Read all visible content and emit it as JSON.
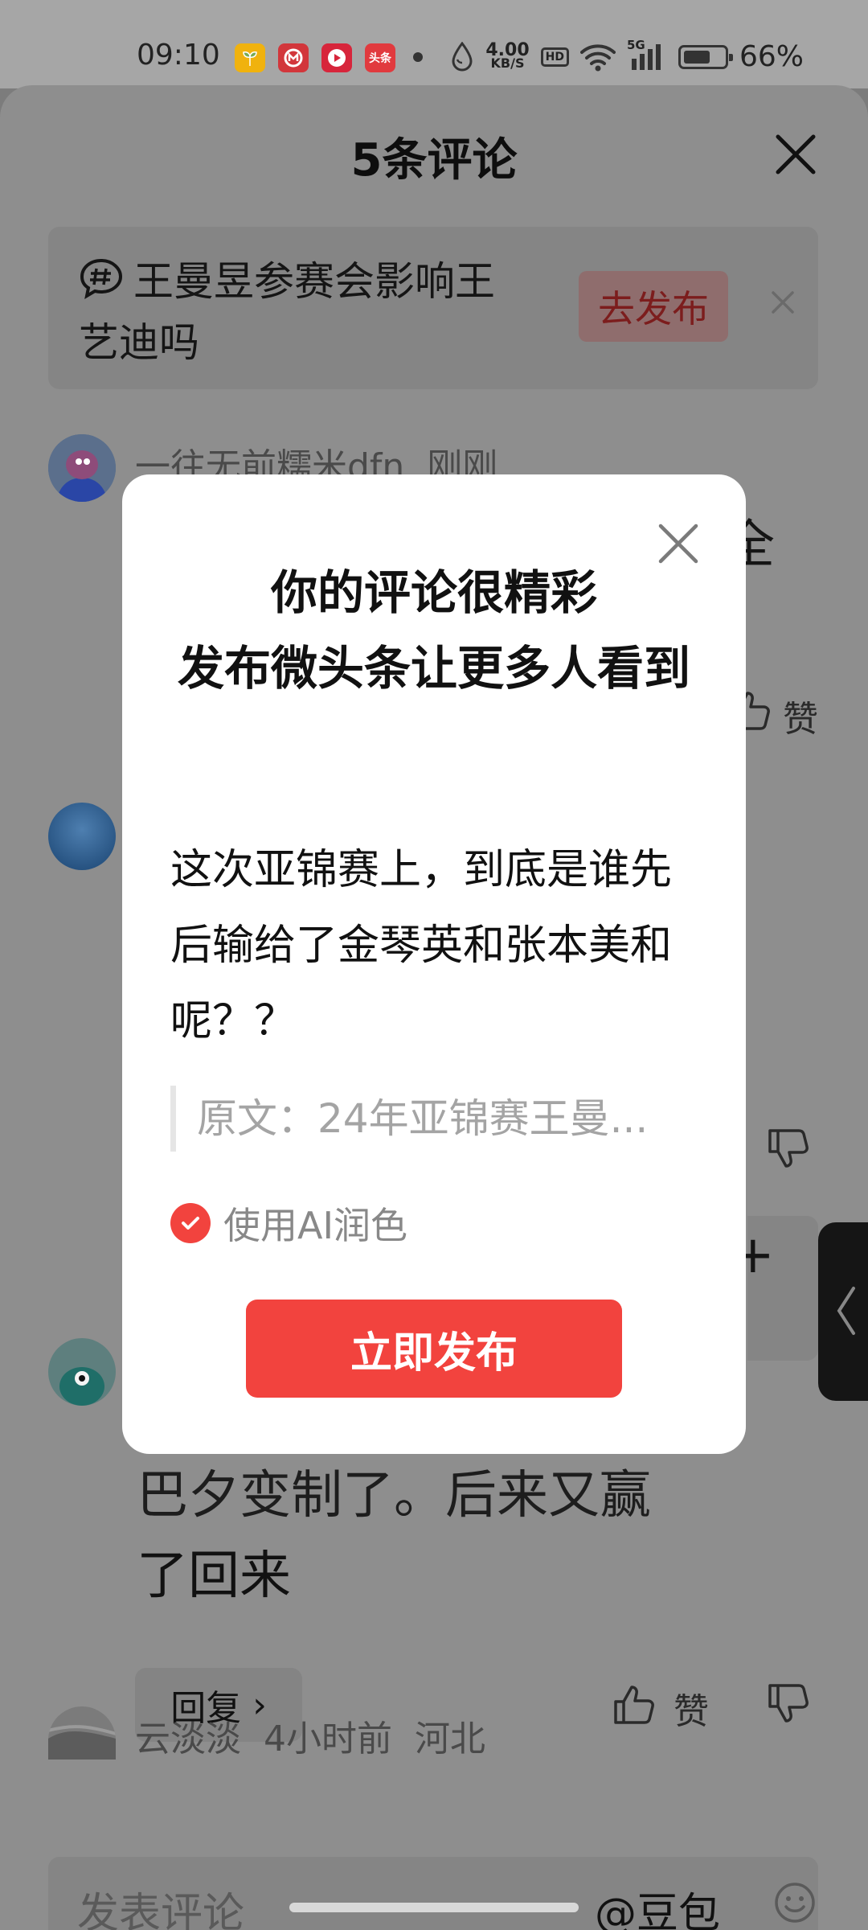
{
  "status_bar": {
    "time": "09:10",
    "net_speed_value": "4.00",
    "net_speed_unit": "KB/S",
    "hd": "HD",
    "signal_type": "5G",
    "battery_percent": "66%",
    "battery_level": 0.66,
    "app_icons": [
      {
        "name": "app-icon-green",
        "color": "#f0b20e"
      },
      {
        "name": "app-icon-bank",
        "color": "#d2363b"
      },
      {
        "name": "app-icon-video",
        "color": "#d7253b"
      },
      {
        "name": "app-icon-toutiao",
        "color": "#e13a3e",
        "label": "头条"
      }
    ]
  },
  "sheet": {
    "title": "5条评论",
    "topic": {
      "text": "王曼昱参赛会影响王艺迪吗",
      "button": "去发布"
    },
    "comments": [
      {
        "user": "一往无前糯米dfn",
        "time": "刚刚",
        "fragment": "全",
        "like": "赞"
      },
      {
        "fragment_partial": ""
      },
      {
        "body_tail": "巴夕变制了。后来又赢",
        "body_last": "了回来",
        "reply": "回复",
        "like": "赞"
      },
      {
        "user": "云淡淡",
        "time": "4小时前",
        "location": "河北"
      }
    ],
    "input_placeholder": "发表评论",
    "mention": "@豆包"
  },
  "dialog": {
    "title_line1": "你的评论很精彩",
    "title_line2": "发布微头条让更多人看到",
    "body": "这次亚锦赛上，到底是谁先后输给了金琴英和张本美和呢？？",
    "quote": "原文：24年亚锦赛王曼...",
    "ai_polish_label": "使用AI润色",
    "ai_polish_checked": true,
    "publish_button": "立即发布"
  },
  "colors": {
    "accent": "#f2433e",
    "overlay": "#8e8e8e"
  }
}
